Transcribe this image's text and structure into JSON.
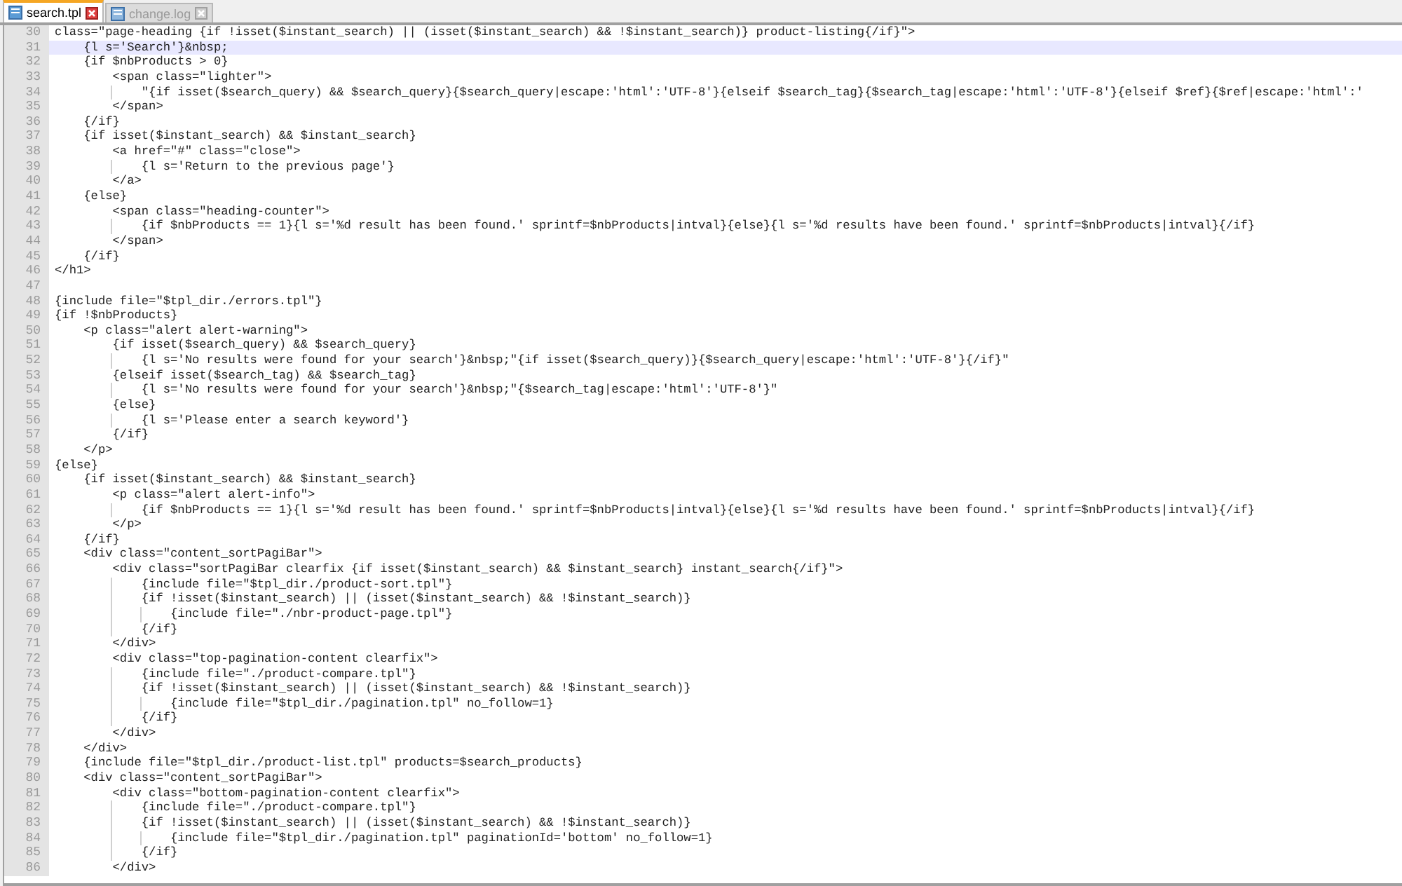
{
  "tabs": [
    {
      "label": "search.tpl",
      "selected": true
    },
    {
      "label": "change.log",
      "selected": false
    }
  ],
  "editor": {
    "lines": [
      {
        "number": "30",
        "text": "class=\"page-heading {if !isset($instant_search) || (isset($instant_search) && !$instant_search)} product-listing{/if}\">",
        "current": false
      },
      {
        "number": "31",
        "text": "    {l s='Search'}&nbsp;",
        "current": true
      },
      {
        "number": "32",
        "text": "    {if $nbProducts > 0}",
        "current": false
      },
      {
        "number": "33",
        "text": "        <span class=\"lighter\">",
        "current": false
      },
      {
        "number": "34",
        "text": "            \"{if isset($search_query) && $search_query}{$search_query|escape:'html':'UTF-8'}{elseif $search_tag}{$search_tag|escape:'html':'UTF-8'}{elseif $ref}{$ref|escape:'html':'",
        "current": false
      },
      {
        "number": "35",
        "text": "        </span>",
        "current": false
      },
      {
        "number": "36",
        "text": "    {/if}",
        "current": false
      },
      {
        "number": "37",
        "text": "    {if isset($instant_search) && $instant_search}",
        "current": false
      },
      {
        "number": "38",
        "text": "        <a href=\"#\" class=\"close\">",
        "current": false
      },
      {
        "number": "39",
        "text": "            {l s='Return to the previous page'}",
        "current": false
      },
      {
        "number": "40",
        "text": "        </a>",
        "current": false
      },
      {
        "number": "41",
        "text": "    {else}",
        "current": false
      },
      {
        "number": "42",
        "text": "        <span class=\"heading-counter\">",
        "current": false
      },
      {
        "number": "43",
        "text": "            {if $nbProducts == 1}{l s='%d result has been found.' sprintf=$nbProducts|intval}{else}{l s='%d results have been found.' sprintf=$nbProducts|intval}{/if}",
        "current": false
      },
      {
        "number": "44",
        "text": "        </span>",
        "current": false
      },
      {
        "number": "45",
        "text": "    {/if}",
        "current": false
      },
      {
        "number": "46",
        "text": "</h1>",
        "current": false
      },
      {
        "number": "47",
        "current": false
      },
      {
        "number": "48",
        "text": "{include file=\"$tpl_dir./errors.tpl\"}",
        "current": false
      },
      {
        "number": "49",
        "text": "{if !$nbProducts}",
        "current": false
      },
      {
        "number": "50",
        "text": "    <p class=\"alert alert-warning\">",
        "current": false
      },
      {
        "number": "51",
        "text": "        {if isset($search_query) && $search_query}",
        "current": false
      },
      {
        "number": "52",
        "text": "            {l s='No results were found for your search'}&nbsp;\"{if isset($search_query)}{$search_query|escape:'html':'UTF-8'}{/if}\"",
        "current": false
      },
      {
        "number": "53",
        "text": "        {elseif isset($search_tag) && $search_tag}",
        "current": false
      },
      {
        "number": "54",
        "text": "            {l s='No results were found for your search'}&nbsp;\"{$search_tag|escape:'html':'UTF-8'}\"",
        "current": false
      },
      {
        "number": "55",
        "text": "        {else}",
        "current": false
      },
      {
        "number": "56",
        "text": "            {l s='Please enter a search keyword'}",
        "current": false
      },
      {
        "number": "57",
        "text": "        {/if}",
        "current": false
      },
      {
        "number": "58",
        "text": "    </p>",
        "current": false
      },
      {
        "number": "59",
        "text": "{else}",
        "current": false
      },
      {
        "number": "60",
        "text": "    {if isset($instant_search) && $instant_search}",
        "current": false
      },
      {
        "number": "61",
        "text": "        <p class=\"alert alert-info\">",
        "current": false
      },
      {
        "number": "62",
        "text": "            {if $nbProducts == 1}{l s='%d result has been found.' sprintf=$nbProducts|intval}{else}{l s='%d results have been found.' sprintf=$nbProducts|intval}{/if}",
        "current": false
      },
      {
        "number": "63",
        "text": "        </p>",
        "current": false
      },
      {
        "number": "64",
        "text": "    {/if}",
        "current": false
      },
      {
        "number": "65",
        "text": "    <div class=\"content_sortPagiBar\">",
        "current": false
      },
      {
        "number": "66",
        "text": "        <div class=\"sortPagiBar clearfix {if isset($instant_search) && $instant_search} instant_search{/if}\">",
        "current": false
      },
      {
        "number": "67",
        "text": "            {include file=\"$tpl_dir./product-sort.tpl\"}",
        "current": false
      },
      {
        "number": "68",
        "text": "            {if !isset($instant_search) || (isset($instant_search) && !$instant_search)}",
        "current": false
      },
      {
        "number": "69",
        "text": "                {include file=\"./nbr-product-page.tpl\"}",
        "current": false
      },
      {
        "number": "70",
        "text": "            {/if}",
        "current": false
      },
      {
        "number": "71",
        "text": "        </div>",
        "current": false
      },
      {
        "number": "72",
        "text": "        <div class=\"top-pagination-content clearfix\">",
        "current": false
      },
      {
        "number": "73",
        "text": "            {include file=\"./product-compare.tpl\"}",
        "current": false
      },
      {
        "number": "74",
        "text": "            {if !isset($instant_search) || (isset($instant_search) && !$instant_search)}",
        "current": false
      },
      {
        "number": "75",
        "text": "                {include file=\"$tpl_dir./pagination.tpl\" no_follow=1}",
        "current": false
      },
      {
        "number": "76",
        "text": "            {/if}",
        "current": false
      },
      {
        "number": "77",
        "text": "        </div>",
        "current": false
      },
      {
        "number": "78",
        "text": "    </div>",
        "current": false
      },
      {
        "number": "79",
        "text": "    {include file=\"$tpl_dir./product-list.tpl\" products=$search_products}",
        "current": false
      },
      {
        "number": "80",
        "text": "    <div class=\"content_sortPagiBar\">",
        "current": false
      },
      {
        "number": "81",
        "text": "        <div class=\"bottom-pagination-content clearfix\">",
        "current": false
      },
      {
        "number": "82",
        "text": "            {include file=\"./product-compare.tpl\"}",
        "current": false
      },
      {
        "number": "83",
        "text": "            {if !isset($instant_search) || (isset($instant_search) && !$instant_search)}",
        "current": false
      },
      {
        "number": "84",
        "text": "                {include file=\"$tpl_dir./pagination.tpl\" paginationId='bottom' no_follow=1}",
        "current": false
      },
      {
        "number": "85",
        "text": "            {/if}",
        "current": false
      },
      {
        "number": "86",
        "text": "        </div>",
        "current": false
      }
    ]
  }
}
